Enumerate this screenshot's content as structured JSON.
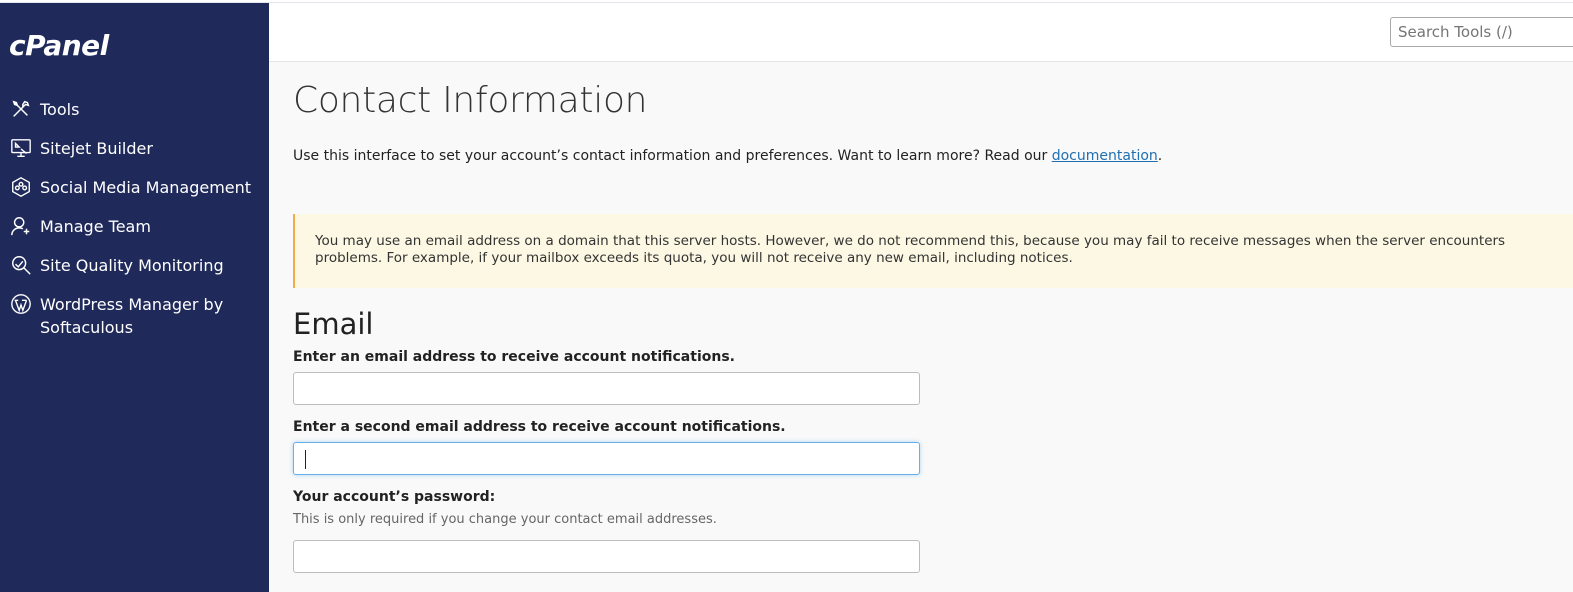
{
  "app": {
    "logo": "cPanel"
  },
  "sidebar": {
    "items": [
      {
        "label": "Tools",
        "icon": "tools-icon"
      },
      {
        "label": "Sitejet Builder",
        "icon": "sitejet-icon"
      },
      {
        "label": "Social Media Management",
        "icon": "social-media-icon"
      },
      {
        "label": "Manage Team",
        "icon": "manage-team-icon"
      },
      {
        "label": "Site Quality Monitoring",
        "icon": "site-quality-icon"
      },
      {
        "label": "WordPress Manager by Softaculous",
        "icon": "wordpress-icon"
      }
    ]
  },
  "header": {
    "search_placeholder": "Search Tools (/)"
  },
  "page": {
    "title": "Contact Information",
    "intro_text": "Use this interface to set your account’s contact information and preferences. Want to learn more? Read our ",
    "intro_link": "documentation",
    "intro_end": ".",
    "alert_text": "You may use an email address on a domain that this server hosts. However, we do not recommend this, because you may fail to receive messages when the server encounters problems. For example, if your mailbox exceeds its quota, you will not receive any new email, including notices."
  },
  "email_section": {
    "title": "Email",
    "email1_label": "Enter an email address to receive account notifications.",
    "email1_value": "",
    "email2_label": "Enter a second email address to receive account notifications.",
    "email2_value": "",
    "password_label": "Your account’s password:",
    "password_help": "This is only required if you change your contact email addresses.",
    "password_value": ""
  }
}
